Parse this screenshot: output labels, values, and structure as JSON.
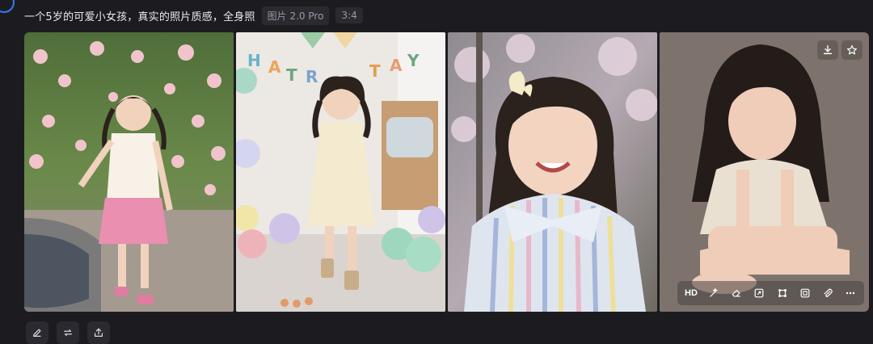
{
  "prompt": {
    "text": "一个5岁的可爱小女孩，真实的照片质感，全身照",
    "model_chip": "图片 2.0 Pro",
    "ratio_chip": "3:4"
  },
  "images": [
    {
      "name": "image-1",
      "alt": "Girl in pink skirt laughing by a fountain in a flower garden"
    },
    {
      "name": "image-2",
      "alt": "Girl running in a birthday party room with balloons"
    },
    {
      "name": "image-3",
      "alt": "Smiling girl in pastel striped shirt with a hair bow"
    },
    {
      "name": "image-4",
      "alt": "Girl sitting in a studio wearing a cream outfit"
    }
  ],
  "hover_toolbar": {
    "hd_label": "HD",
    "icons": [
      "magic-wand-icon",
      "eraser-icon",
      "expand-icon",
      "crop-icon",
      "fit-icon",
      "paperclip-icon",
      "more-icon"
    ]
  },
  "top_actions": [
    "download-icon",
    "star-icon"
  ],
  "bottom_actions": [
    "edit-icon",
    "regenerate-icon",
    "share-icon"
  ],
  "colors": {
    "background": "#1c1c20",
    "chip_bg": "#2a2a30",
    "accent": "#2f7cf6"
  }
}
